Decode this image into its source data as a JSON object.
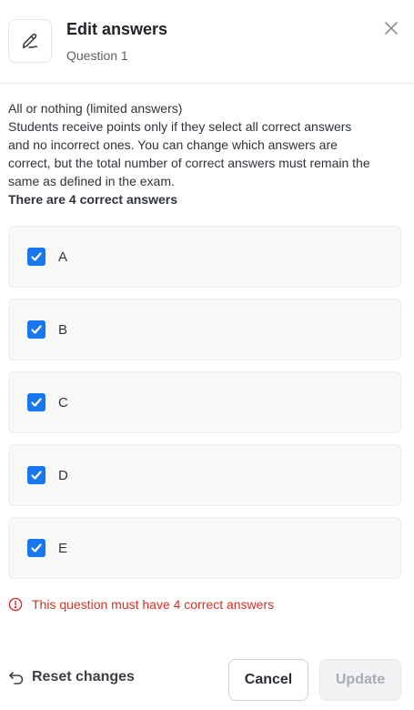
{
  "header": {
    "title": "Edit answers",
    "subtitle": "Question 1",
    "icon": "pencil-icon",
    "close_icon": "close-icon"
  },
  "description": {
    "mode": "All or nothing (limited answers)",
    "line1": "Students receive points only if they select all correct answers",
    "line2": "and no incorrect ones. You can change which answers are",
    "line3": "correct, but the total number of correct answers must remain the",
    "line4": "same as defined in the exam.",
    "correct_count": "There are 4 correct answers"
  },
  "options": [
    {
      "label": "A",
      "checked": true
    },
    {
      "label": "B",
      "checked": true
    },
    {
      "label": "C",
      "checked": true
    },
    {
      "label": "D",
      "checked": true
    },
    {
      "label": "E",
      "checked": true
    }
  ],
  "error": {
    "icon": "alert-circle-icon",
    "text": "This question must have 4 correct answers",
    "color": "#d93025"
  },
  "footer": {
    "reset_label": "Reset changes",
    "reset_icon": "undo-arrow-icon",
    "cancel_label": "Cancel",
    "update_label": "Update"
  },
  "colors": {
    "accent": "#1677ee",
    "error": "#d93025"
  }
}
